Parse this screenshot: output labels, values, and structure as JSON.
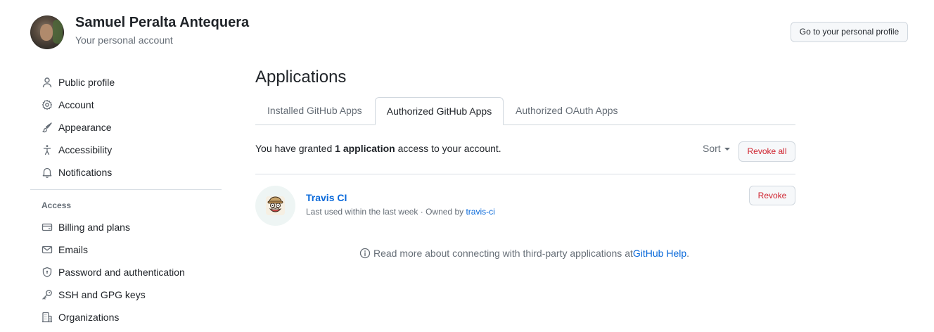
{
  "user": {
    "name": "Samuel Peralta Antequera",
    "subtitle": "Your personal account",
    "profile_button": "Go to your personal profile"
  },
  "sidebar": {
    "items": [
      {
        "label": "Public profile",
        "icon": "person-icon"
      },
      {
        "label": "Account",
        "icon": "gear-icon"
      },
      {
        "label": "Appearance",
        "icon": "paintbrush-icon"
      },
      {
        "label": "Accessibility",
        "icon": "accessibility-icon"
      },
      {
        "label": "Notifications",
        "icon": "bell-icon"
      }
    ],
    "access_heading": "Access",
    "access_items": [
      {
        "label": "Billing and plans",
        "icon": "credit-card-icon"
      },
      {
        "label": "Emails",
        "icon": "mail-icon"
      },
      {
        "label": "Password and authentication",
        "icon": "shield-lock-icon"
      },
      {
        "label": "SSH and GPG keys",
        "icon": "key-icon"
      },
      {
        "label": "Organizations",
        "icon": "organization-icon"
      }
    ]
  },
  "main": {
    "title": "Applications",
    "tabs": [
      {
        "label": "Installed GitHub Apps",
        "selected": false
      },
      {
        "label": "Authorized GitHub Apps",
        "selected": true
      },
      {
        "label": "Authorized OAuth Apps",
        "selected": false
      }
    ],
    "granted_prefix": "You have granted ",
    "granted_count": "1 application",
    "granted_suffix": " access to your account.",
    "sort_label": "Sort",
    "revoke_all_label": "Revoke all",
    "apps": [
      {
        "name": "Travis CI",
        "meta_prefix": "Last used within the last week · Owned by ",
        "owner": "travis-ci",
        "revoke_label": "Revoke",
        "icon": "travis-ci-mascot-icon"
      }
    ],
    "help_prefix": "Read more about connecting with third-party applications at ",
    "help_link": "GitHub Help",
    "help_suffix": "."
  },
  "colors": {
    "link": "#0969da",
    "danger": "#cf222e",
    "muted": "#656d76",
    "border": "#d0d7de"
  }
}
